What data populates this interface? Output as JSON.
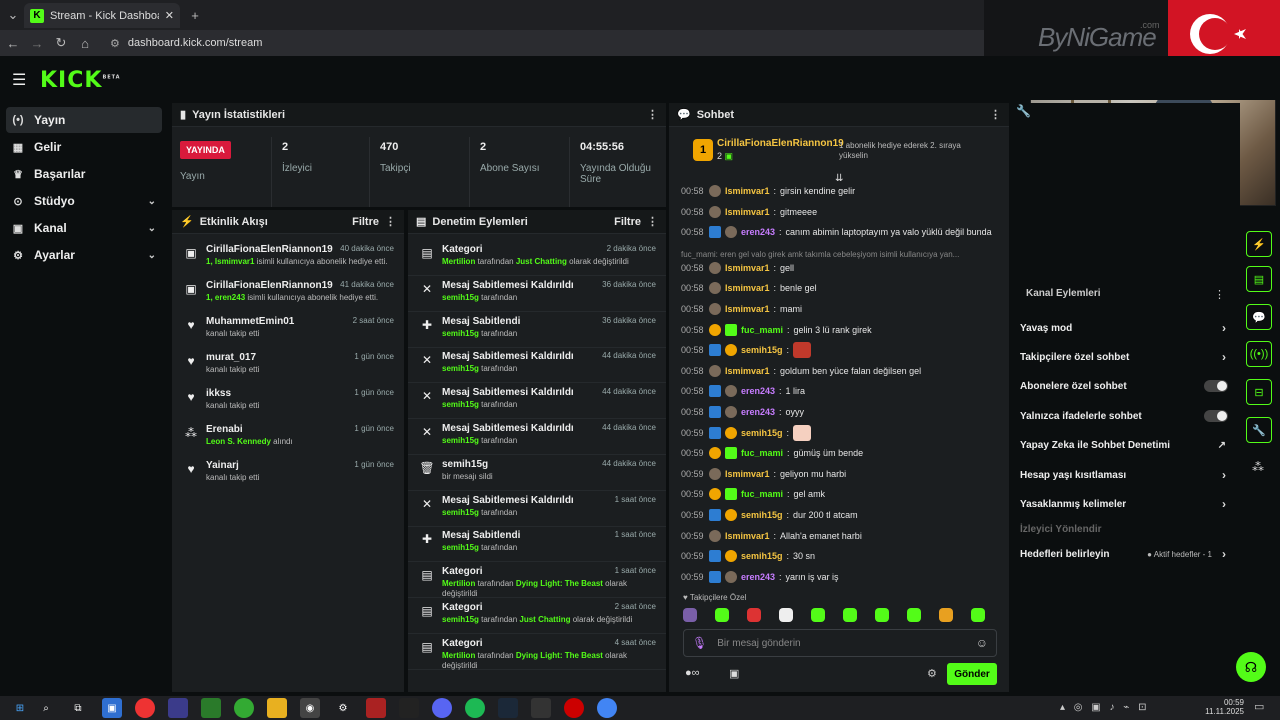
{
  "browser": {
    "tab_title": "Stream - Kick Dashboard",
    "url": "dashboard.kick.com/stream"
  },
  "overlay": {
    "watermark": "ByNiGame",
    "watermark_suffix": ".com"
  },
  "brand": {
    "logo": "KICK",
    "beta": "BETA"
  },
  "sidebar": {
    "items": [
      {
        "label": "Yayın",
        "icon": "broadcast-icon",
        "chev": ""
      },
      {
        "label": "Gelir",
        "icon": "revenue-icon",
        "chev": ""
      },
      {
        "label": "Başarılar",
        "icon": "trophy-icon",
        "chev": ""
      },
      {
        "label": "Stüdyo",
        "icon": "studio-icon",
        "chev": "⌄"
      },
      {
        "label": "Kanal",
        "icon": "channel-icon",
        "chev": "⌄"
      },
      {
        "label": "Ayarlar",
        "icon": "gear-icon",
        "chev": "⌄"
      }
    ]
  },
  "stats": {
    "title": "Yayın İstatistikleri",
    "live": "YAYINDA",
    "live_label": "Yayın",
    "items": [
      {
        "value": "2",
        "label": "İzleyici"
      },
      {
        "value": "470",
        "label": "Takipçi"
      },
      {
        "value": "2",
        "label": "Abone Sayısı"
      },
      {
        "value": "04:55:56",
        "label": "Yayında Olduğu Süre"
      }
    ]
  },
  "activity": {
    "title": "Etkinlik Akışı",
    "filter": "Filtre",
    "items": [
      {
        "icon": "gift-icon",
        "name": "CirillaFionaElenRiannon19",
        "time": "40 dakika önce",
        "hl": "1, Ismimvar1",
        "sub": " isimli kullanıcıya abonelik hediye etti."
      },
      {
        "icon": "gift-icon",
        "name": "CirillaFionaElenRiannon19",
        "time": "41 dakika önce",
        "hl": "1, eren243",
        "sub": " isimli kullanıcıya abonelik hediye etti."
      },
      {
        "icon": "heart-icon",
        "name": "MuhammetEmin01",
        "time": "2 saat önce",
        "hl": "",
        "sub": "kanalı takip etti"
      },
      {
        "icon": "heart-icon",
        "name": "murat_017",
        "time": "1 gün önce",
        "hl": "",
        "sub": "kanalı takip etti"
      },
      {
        "icon": "heart-icon",
        "name": "ikkss",
        "time": "1 gün önce",
        "hl": "",
        "sub": "kanalı takip etti"
      },
      {
        "icon": "shapes-icon",
        "name": "Erenabi",
        "time": "1 gün önce",
        "hl": "Leon S. Kennedy",
        "sub": " alındı"
      },
      {
        "icon": "heart-icon",
        "name": "Yainarj",
        "time": "1 gün önce",
        "hl": "",
        "sub": "kanalı takip etti"
      }
    ]
  },
  "moderation": {
    "title": "Denetim Eylemleri",
    "filter": "Filtre",
    "items": [
      {
        "icon": "category-icon",
        "title": "Kategori",
        "time": "2 dakika önce",
        "u": "Mertilion",
        "mid": " tarafından ",
        "g": "Just Chatting",
        "end": " olarak değiştirildi"
      },
      {
        "icon": "unpin-icon",
        "title": "Mesaj Sabitlemesi Kaldırıldı",
        "time": "36 dakika önce",
        "u": "semih15g",
        "mid": " tarafından",
        "g": "",
        "end": ""
      },
      {
        "icon": "pin-icon",
        "title": "Mesaj Sabitlendi",
        "time": "36 dakika önce",
        "u": "semih15g",
        "mid": " tarafından",
        "g": "",
        "end": ""
      },
      {
        "icon": "unpin-icon",
        "title": "Mesaj Sabitlemesi Kaldırıldı",
        "time": "44 dakika önce",
        "u": "semih15g",
        "mid": " tarafından",
        "g": "",
        "end": ""
      },
      {
        "icon": "unpin-icon",
        "title": "Mesaj Sabitlemesi Kaldırıldı",
        "time": "44 dakika önce",
        "u": "semih15g",
        "mid": " tarafından",
        "g": "",
        "end": ""
      },
      {
        "icon": "unpin-icon",
        "title": "Mesaj Sabitlemesi Kaldırıldı",
        "time": "44 dakika önce",
        "u": "semih15g",
        "mid": " tarafından",
        "g": "",
        "end": ""
      },
      {
        "icon": "trash-icon",
        "title": "semih15g",
        "time": "44 dakika önce",
        "u": "",
        "mid": "bir mesajı sildi",
        "g": "",
        "end": ""
      },
      {
        "icon": "unpin-icon",
        "title": "Mesaj Sabitlemesi Kaldırıldı",
        "time": "1 saat önce",
        "u": "semih15g",
        "mid": " tarafından",
        "g": "",
        "end": ""
      },
      {
        "icon": "pin-icon",
        "title": "Mesaj Sabitlendi",
        "time": "1 saat önce",
        "u": "semih15g",
        "mid": " tarafından",
        "g": "",
        "end": ""
      },
      {
        "icon": "category-icon",
        "title": "Kategori",
        "time": "1 saat önce",
        "u": "Mertilion",
        "mid": " tarafından ",
        "g": "Dying Light: The Beast",
        "end": " olarak değiştirildi"
      },
      {
        "icon": "category-icon",
        "title": "Kategori",
        "time": "2 saat önce",
        "u": "semih15g",
        "mid": " tarafından ",
        "g": "Just Chatting",
        "end": " olarak değiştirildi"
      },
      {
        "icon": "category-icon",
        "title": "Kategori",
        "time": "4 saat önce",
        "u": "Mertilion",
        "mid": " tarafından ",
        "g": "Dying Light: The Beast",
        "end": " olarak değiştirildi"
      }
    ]
  },
  "chat": {
    "title": "Sohbet",
    "pinned_user": "CirillaFionaElenRiannon19",
    "pinned_count": "2",
    "pinned_note": "1 abonelik hediye ederek 2. sıraya yükselin",
    "messages": [
      {
        "ts": "00:58",
        "b": [
          "av"
        ],
        "u": "Ismimvar1",
        "c": "#f5c542",
        "m": "girsin kendine gelir"
      },
      {
        "ts": "00:58",
        "b": [
          "av"
        ],
        "u": "Ismimvar1",
        "c": "#f5c542",
        "m": "gitmeeee"
      },
      {
        "ts": "00:58",
        "b": [
          "mod",
          "av"
        ],
        "u": "eren243",
        "c": "#c77dff",
        "m": "canım abimin laptoptayım ya valo yüklü değil bunda"
      },
      {
        "ts": "00:58",
        "b": [
          "av"
        ],
        "u": "Ismimvar1",
        "c": "#f5c542",
        "m": "gell"
      },
      {
        "ts": "00:58",
        "b": [
          "av"
        ],
        "u": "Ismimvar1",
        "c": "#f5c542",
        "m": "benle gel"
      },
      {
        "ts": "00:58",
        "b": [
          "av"
        ],
        "u": "Ismimvar1",
        "c": "#f5c542",
        "m": "mami"
      },
      {
        "ts": "00:58",
        "b": [
          "sub",
          "gift"
        ],
        "u": "fuc_mami",
        "c": "#53fc18",
        "m": "gelin 3 lü rank girek"
      },
      {
        "ts": "00:58",
        "b": [
          "mod",
          "sub"
        ],
        "u": "semih15g",
        "c": "#f5c542",
        "m": ""
      },
      {
        "ts": "00:58",
        "b": [
          "av"
        ],
        "u": "Ismimvar1",
        "c": "#f5c542",
        "m": "goldum ben yüce falan değilsen gel"
      },
      {
        "ts": "00:58",
        "b": [
          "mod",
          "av"
        ],
        "u": "eren243",
        "c": "#c77dff",
        "m": "1 lira"
      },
      {
        "ts": "00:58",
        "b": [
          "mod",
          "av"
        ],
        "u": "eren243",
        "c": "#c77dff",
        "m": "oyyy"
      },
      {
        "ts": "00:59",
        "b": [
          "mod",
          "sub"
        ],
        "u": "semih15g",
        "c": "#f5c542",
        "m": ""
      },
      {
        "ts": "00:59",
        "b": [
          "sub",
          "gift"
        ],
        "u": "fuc_mami",
        "c": "#53fc18",
        "m": "gümüş üm bende"
      },
      {
        "ts": "00:59",
        "b": [
          "av"
        ],
        "u": "Ismimvar1",
        "c": "#f5c542",
        "m": "geliyon mu harbi"
      },
      {
        "ts": "00:59",
        "b": [
          "sub",
          "gift"
        ],
        "u": "fuc_mami",
        "c": "#53fc18",
        "m": "gel amk"
      },
      {
        "ts": "00:59",
        "b": [
          "mod",
          "sub"
        ],
        "u": "semih15g",
        "c": "#f5c542",
        "m": "dur 200 tl atcam"
      },
      {
        "ts": "00:59",
        "b": [
          "av"
        ],
        "u": "Ismimvar1",
        "c": "#f5c542",
        "m": "Allah'a emanet harbi"
      },
      {
        "ts": "00:59",
        "b": [
          "mod",
          "sub"
        ],
        "u": "semih15g",
        "c": "#f5c542",
        "m": "30 sn"
      },
      {
        "ts": "00:59",
        "b": [
          "mod",
          "av"
        ],
        "u": "eren243",
        "c": "#c77dff",
        "m": "yarın iş var iş"
      }
    ],
    "reply_hint": "fuc_mami: eren gel valo girek amk takımla cebeleşiyom isimli kullanıcıya yan...",
    "emote_label": "Takipçilere Özel",
    "input_placeholder": "Bir mesaj gönderin",
    "send": "Gönder"
  },
  "overlay_chat": [
    {
      "u": "fuc_mami",
      "m": ": gel amk",
      "c": "#c77dff"
    },
    {
      "u": "semih15g",
      "m": ": dur 200 tl atcam",
      "c": "#ffffff"
    },
    {
      "u": "Ismimvar1",
      "m": ": Allah'a emanet harbi",
      "c": "#f5c542"
    },
    {
      "u": "semih15g",
      "m": ": 30 sn",
      "c": "#ffffff"
    },
    {
      "u": "eren243",
      "m": ": yarın iş var iş",
      "c": "#c77dff"
    }
  ],
  "settings": {
    "items": [
      {
        "label": "Yavaş mod",
        "type": "arrow",
        "extra": ""
      },
      {
        "label": "Takipçilere özel sohbet",
        "type": "arrow",
        "extra": ""
      },
      {
        "label": "Abonelere özel sohbet",
        "type": "toggle",
        "extra": ""
      },
      {
        "label": "Yalnızca ifadelerle sohbet",
        "type": "toggle",
        "extra": ""
      },
      {
        "label": "Yapay Zeka ile Sohbet Denetimi",
        "type": "ext",
        "extra": ""
      },
      {
        "label": "Hesap yaşı kısıtlaması",
        "type": "arrow",
        "extra": ""
      },
      {
        "label": "Yasaklanmış kelimeler",
        "type": "arrow",
        "extra": ""
      },
      {
        "label": "İzleyici Yönlendir",
        "type": "dim",
        "extra": ""
      },
      {
        "label": "Hedefleri belirleyin",
        "type": "arrow",
        "extra": "● Aktif hedefler - 1"
      }
    ],
    "header": "Kanal Eylemleri"
  },
  "taskbar": {
    "time": "00:59",
    "date": "11.11.2025"
  },
  "colors": {
    "accent": "#53fc18",
    "live": "#d91a3c",
    "panel": "#1b1e20"
  }
}
